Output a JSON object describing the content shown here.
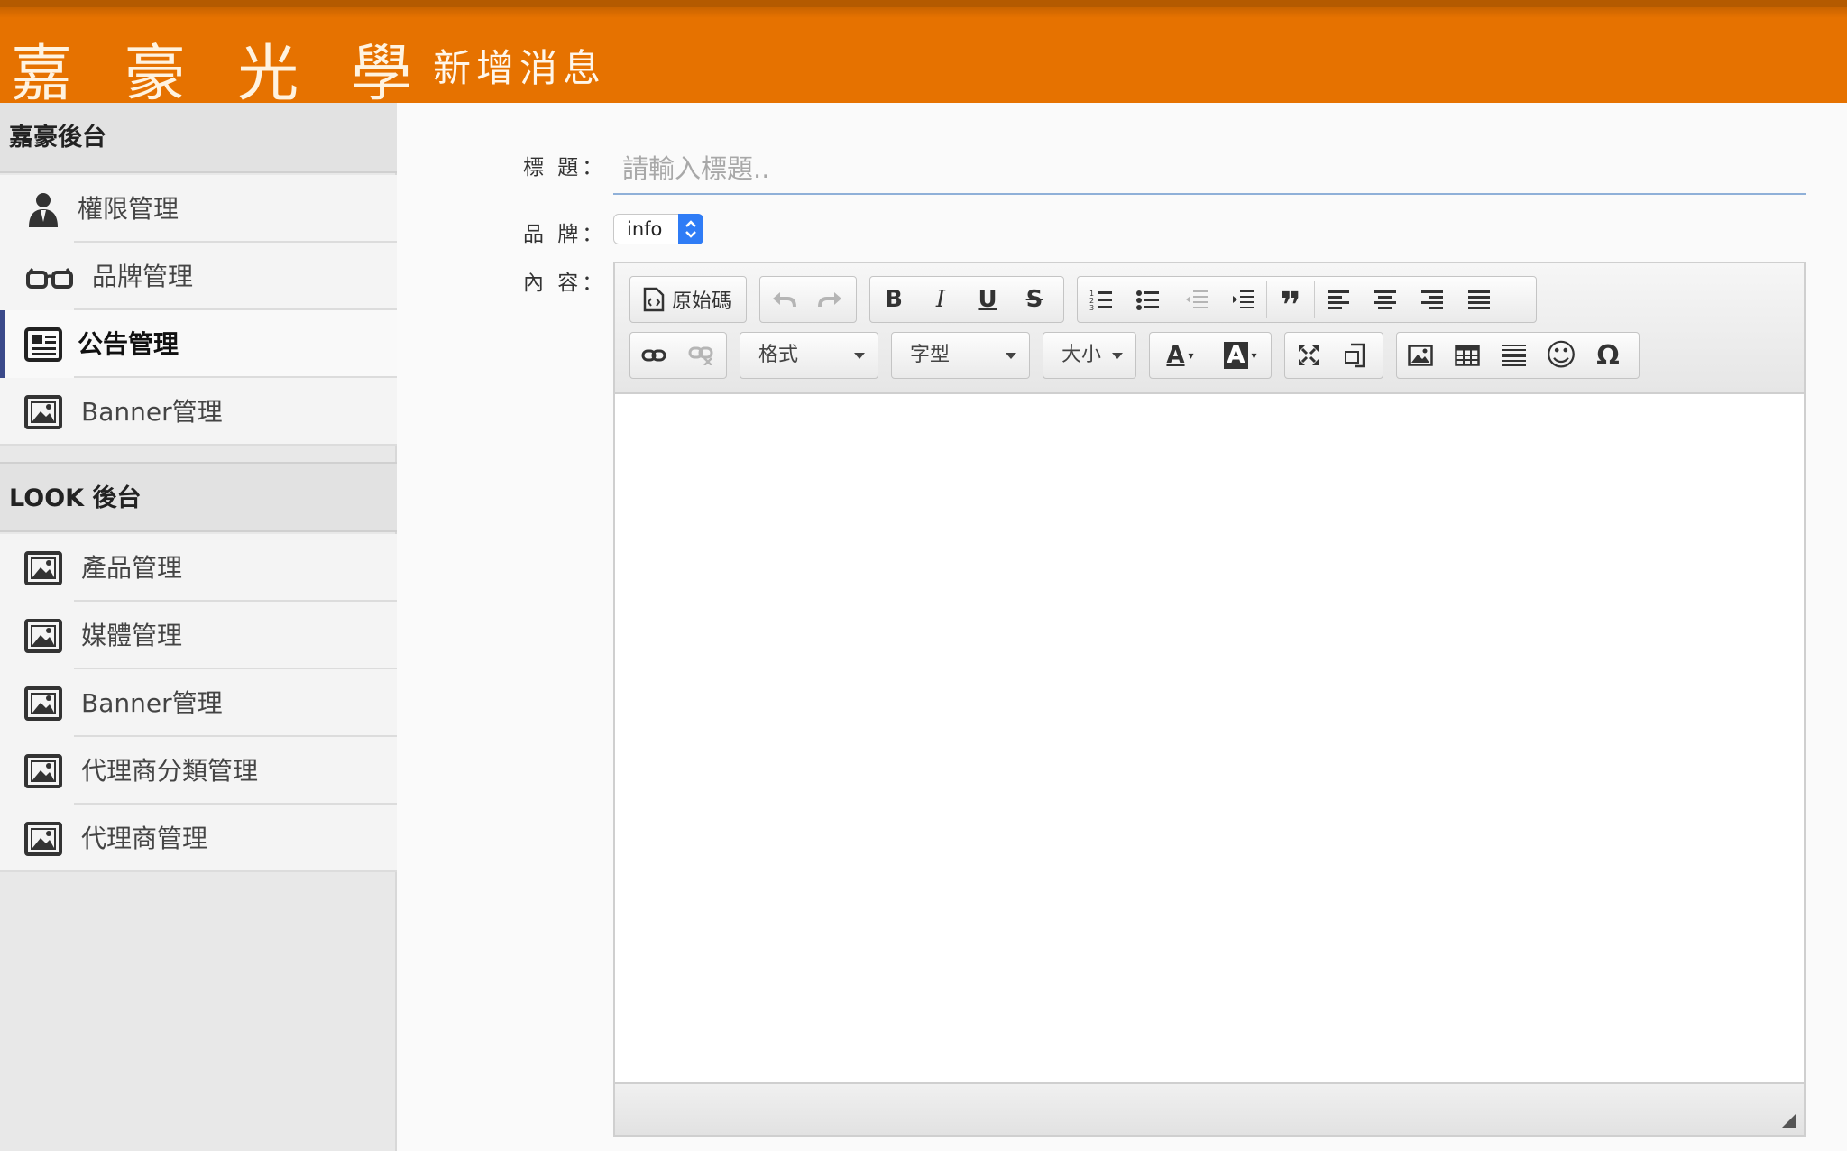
{
  "header": {
    "brand": "嘉 豪 光 學",
    "page_title": "新增消息"
  },
  "sidebar": {
    "sections": [
      {
        "title": "嘉豪後台",
        "items": [
          {
            "label": "權限管理",
            "icon": "user-icon"
          },
          {
            "label": "品牌管理",
            "icon": "glasses-icon"
          },
          {
            "label": "公告管理",
            "icon": "newspaper-icon",
            "active": true
          },
          {
            "label": "Banner管理",
            "icon": "image-icon"
          }
        ]
      },
      {
        "title": "LOOK 後台",
        "items": [
          {
            "label": "產品管理",
            "icon": "image-icon"
          },
          {
            "label": "媒體管理",
            "icon": "image-icon"
          },
          {
            "label": "Banner管理",
            "icon": "image-icon"
          },
          {
            "label": "代理商分類管理",
            "icon": "image-icon"
          },
          {
            "label": "代理商管理",
            "icon": "image-icon"
          }
        ]
      }
    ]
  },
  "form": {
    "title_label": "標 題：",
    "title_placeholder": "請輸入標題..",
    "brand_label": "品 牌：",
    "brand_value": "info",
    "content_label": "內 容："
  },
  "editor": {
    "source_label": "原始碼",
    "format_label": "格式",
    "font_label": "字型",
    "size_label": "大小",
    "bold": "B",
    "italic": "I",
    "underline": "U",
    "strike": "S",
    "quote": "❞",
    "omega": "Ω",
    "smiley": "☺",
    "text_color": "A",
    "bg_color": "A",
    "accent_color": "#e67200"
  }
}
